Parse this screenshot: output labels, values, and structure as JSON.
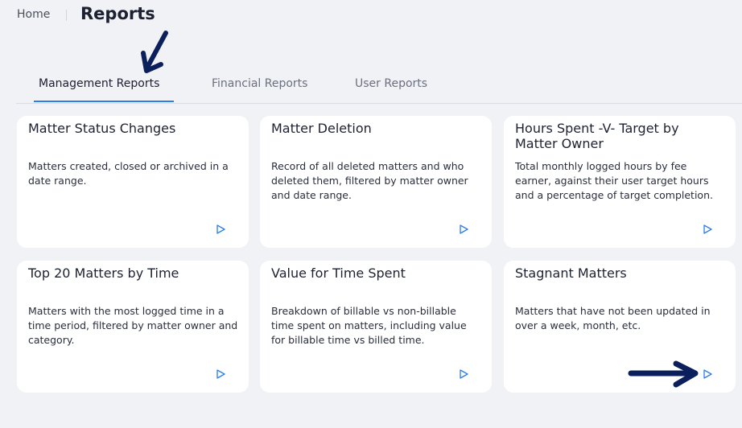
{
  "breadcrumb": {
    "home": "Home",
    "title": "Reports"
  },
  "tabs": [
    {
      "label": "Management Reports",
      "active": true
    },
    {
      "label": "Financial Reports",
      "active": false
    },
    {
      "label": "User Reports",
      "active": false
    }
  ],
  "cards": [
    {
      "title": "Matter Status Changes",
      "description": "Matters created, closed or archived in a date range."
    },
    {
      "title": "Matter Deletion",
      "description": "Record of all deleted matters and who deleted them, filtered by matter owner and date range."
    },
    {
      "title": "Hours Spent -V- Target by Matter Owner",
      "description": "Total monthly logged hours by fee earner, against their user target hours and a percentage of target completion."
    },
    {
      "title": "Top 20 Matters by Time",
      "description": "Matters with the most logged time in a time period, filtered by matter owner and category."
    },
    {
      "title": "Value for Time Spent",
      "description": "Breakdown of billable vs non-billable time spent on matters, including value for billable time vs billed time."
    },
    {
      "title": "Stagnant Matters",
      "description": "Matters that have not been updated in over a week, month, etc."
    }
  ],
  "icons": {
    "run": "play-outline-icon",
    "annotation": "arrow-annotation-icon"
  },
  "colors": {
    "accent": "#2b7de9",
    "annotation": "#0b1f5c",
    "background": "#f1f2f6",
    "card": "#ffffff"
  }
}
